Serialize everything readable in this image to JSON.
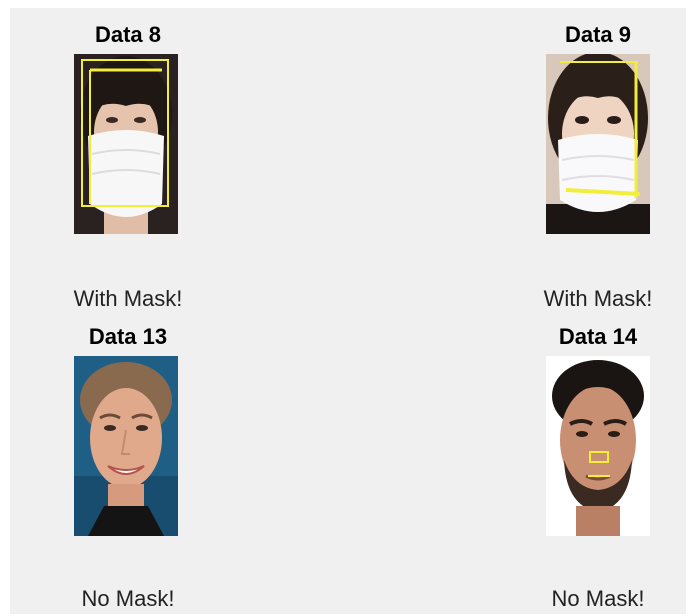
{
  "panels": [
    {
      "title": "Data 8",
      "result": "With Mask!"
    },
    {
      "title": "Data 9",
      "result": "With Mask!"
    },
    {
      "title": "Data 13",
      "result": "No Mask!"
    },
    {
      "title": "Data 14",
      "result": "No Mask!"
    }
  ],
  "colors": {
    "figure_background": "#f0f0f0",
    "detection_box": "#f2ee3a"
  }
}
